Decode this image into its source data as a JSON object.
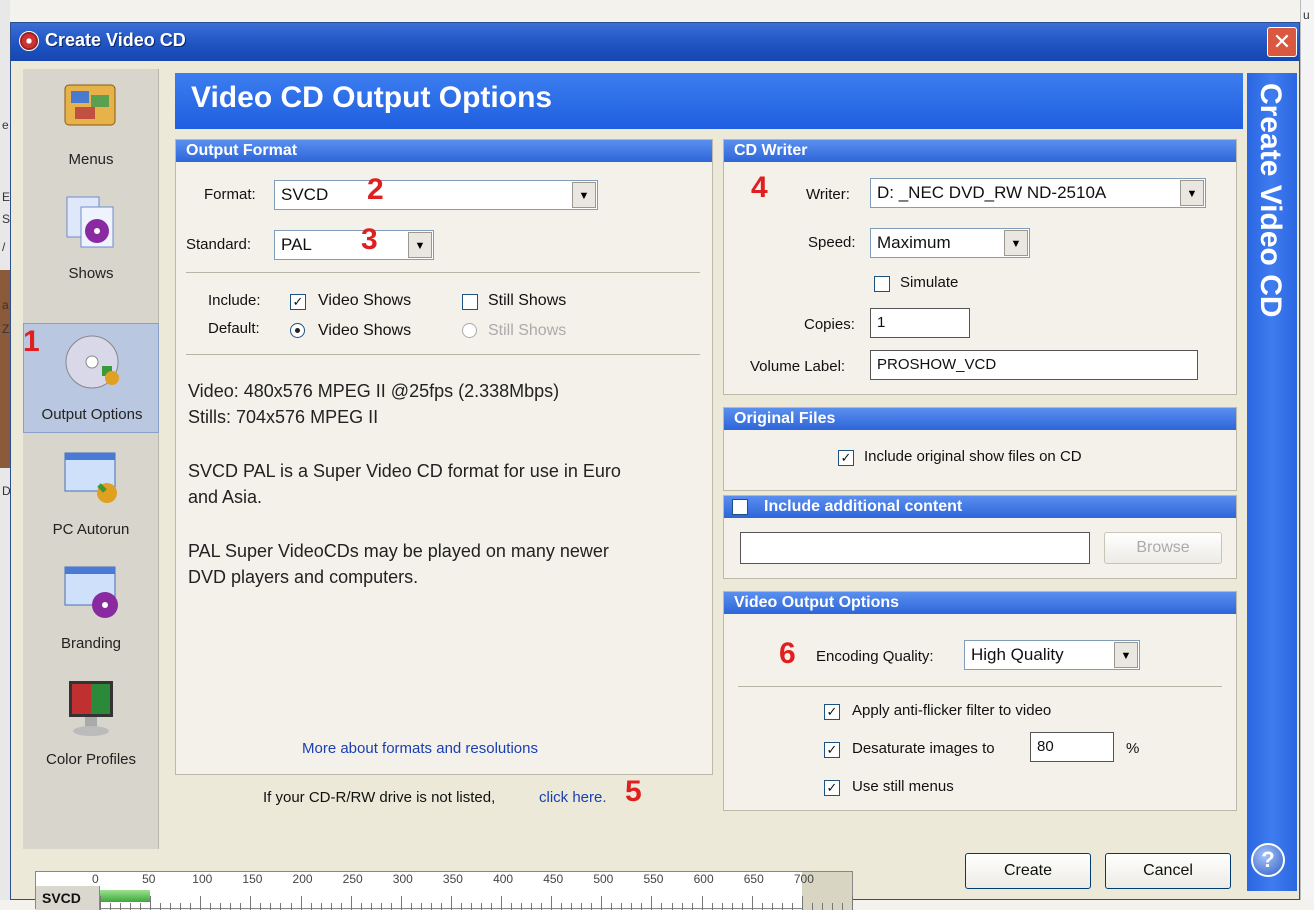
{
  "window": {
    "title": "Create Video CD",
    "close": "✕"
  },
  "nav": [
    {
      "label": "Menus",
      "icon": "menus-icon"
    },
    {
      "label": "Shows",
      "icon": "shows-icon"
    },
    {
      "label": "Output Options",
      "icon": "output-options-icon"
    },
    {
      "label": "PC Autorun",
      "icon": "pc-autorun-icon"
    },
    {
      "label": "Branding",
      "icon": "branding-icon"
    },
    {
      "label": "Color Profiles",
      "icon": "color-profiles-icon"
    }
  ],
  "header": {
    "title": "Video CD Output Options",
    "banner": "Create Video CD"
  },
  "output_format": {
    "heading": "Output Format",
    "format_label": "Format:",
    "format_value": "SVCD",
    "standard_label": "Standard:",
    "standard_value": "PAL",
    "include_label": "Include:",
    "default_label": "Default:",
    "include_video": "Video Shows",
    "include_still": "Still Shows",
    "default_video": "Video Shows",
    "default_still": "Still Shows",
    "include_video_checked": true,
    "include_still_checked": false,
    "desc1": "Video: 480x576 MPEG II @25fps (2.338Mbps)",
    "desc2": "Stills: 704x576 MPEG II",
    "desc3a": "SVCD PAL is a Super Video CD format for use in Euro",
    "desc3b": "and Asia.",
    "desc4a": "PAL Super VideoCDs may be played on many newer",
    "desc4b": "DVD players and computers.",
    "more_link": "More about formats and resolutions"
  },
  "footer_note": {
    "text": "If your CD-R/RW drive is not listed,",
    "link": "click here."
  },
  "cd_writer": {
    "heading": "CD Writer",
    "writer_label": "Writer:",
    "writer_value": "D: _NEC DVD_RW ND-2510A",
    "speed_label": "Speed:",
    "speed_value": "Maximum",
    "simulate_label": "Simulate",
    "copies_label": "Copies:",
    "copies_value": "1",
    "volume_label": "Volume Label:",
    "volume_value": "PROSHOW_VCD"
  },
  "original_files": {
    "heading": "Original Files",
    "include_label": "Include original show files on CD"
  },
  "additional": {
    "heading": "Include additional content",
    "path": "",
    "browse": "Browse"
  },
  "video_output": {
    "heading": "Video Output Options",
    "quality_label": "Encoding Quality:",
    "quality_value": "High Quality",
    "antiflicker": "Apply anti-flicker filter to video",
    "desaturate": "Desaturate images to",
    "desaturate_value": "80",
    "percent": "%",
    "still_menus": "Use still menus"
  },
  "markers": [
    "1",
    "2",
    "3",
    "4",
    "5",
    "6"
  ],
  "ruler": {
    "label": "SVCD",
    "ticks": [
      "0",
      "50",
      "100",
      "150",
      "200",
      "250",
      "300",
      "350",
      "400",
      "450",
      "500",
      "550",
      "600",
      "650",
      "700"
    ],
    "used": 50,
    "max": 700,
    "capacity": 700
  },
  "buttons": {
    "create": "Create",
    "cancel": "Cancel"
  },
  "edge_text": {
    "top_right": "u",
    "left": [
      "e",
      "E",
      "S",
      "/",
      "a",
      "Z",
      "D"
    ]
  }
}
